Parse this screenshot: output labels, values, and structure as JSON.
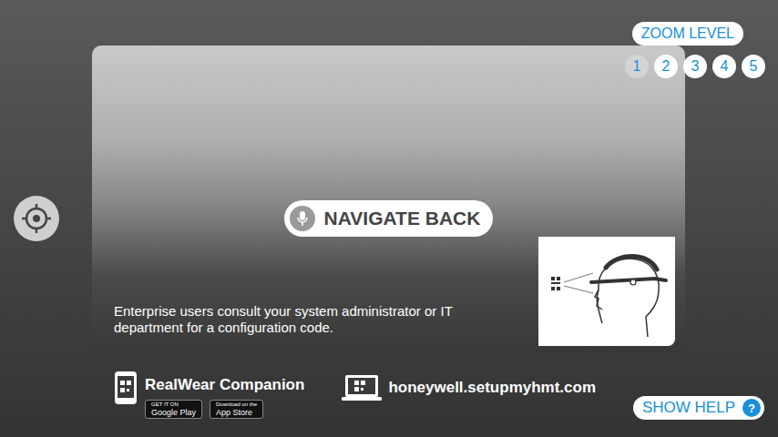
{
  "zoom": {
    "label": "ZOOM LEVEL",
    "levels": [
      {
        "label": "1",
        "selected": true
      },
      {
        "label": "2",
        "selected": false
      },
      {
        "label": "3",
        "selected": false
      },
      {
        "label": "4",
        "selected": false
      },
      {
        "label": "5",
        "selected": false
      }
    ]
  },
  "voice_command": {
    "label": "NAVIGATE BACK"
  },
  "help_text": "Enterprise users consult your system administrator or IT department for a configuration code.",
  "companion": {
    "title": "RealWear Companion",
    "stores": [
      {
        "small": "GET IT ON",
        "name": "Google Play"
      },
      {
        "small": "Download on the",
        "name": "App Store"
      }
    ]
  },
  "website": "honeywell.setupmyhmt.com",
  "show_help": {
    "label": "SHOW HELP",
    "icon": "?"
  }
}
